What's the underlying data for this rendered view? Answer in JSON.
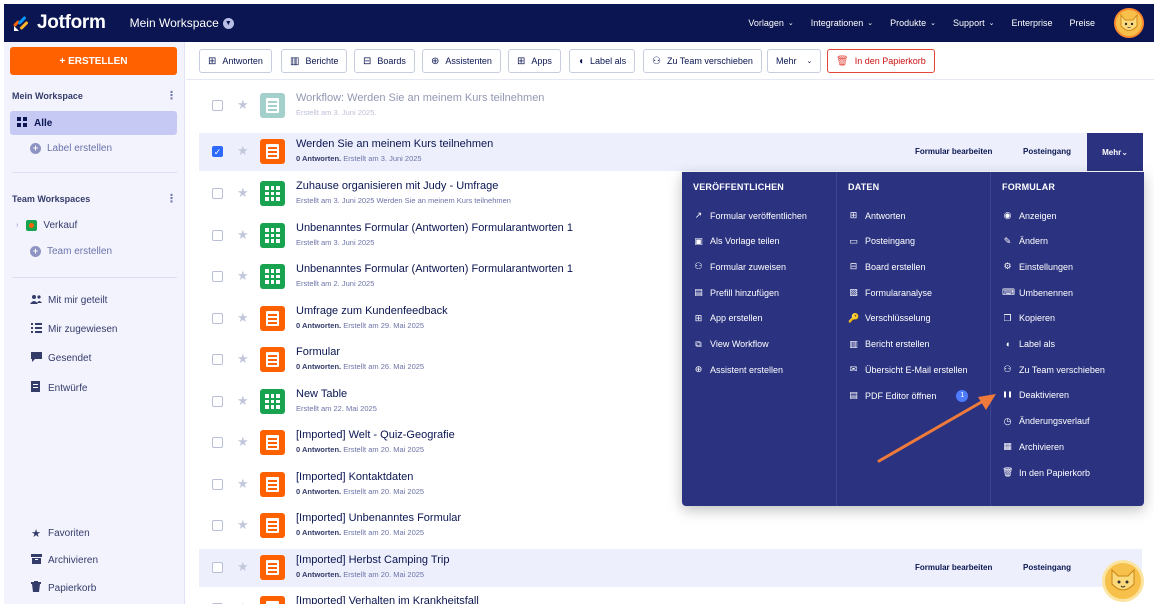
{
  "header": {
    "logo_text": "Jotform",
    "workspace": "Mein Workspace",
    "nav": [
      "Vorlagen",
      "Integrationen",
      "Produkte",
      "Support",
      "Enterprise",
      "Preise"
    ],
    "nav_chevrons": [
      true,
      true,
      true,
      true,
      false,
      false
    ]
  },
  "sidebar": {
    "create_label": "+ ERSTELLEN",
    "section_workspace": "Mein Workspace",
    "all_label": "Alle",
    "create_label_link": "Label erstellen",
    "section_team": "Team Workspaces",
    "team_name": "Verkauf",
    "create_team": "Team erstellen",
    "shared": "Mit mir geteilt",
    "assigned": "Mir zugewiesen",
    "sent": "Gesendet",
    "drafts": "Entwürfe",
    "favorites": "Favoriten",
    "archive": "Archivieren",
    "trash": "Papierkorb"
  },
  "toolbar": {
    "buttons": [
      "Antworten",
      "Berichte",
      "Boards",
      "Assistenten",
      "Apps",
      "Label als",
      "Zu Team verschieben",
      "Mehr",
      "In den Papierkorb"
    ]
  },
  "forms": [
    {
      "title": "Workflow: Werden Sie an meinem Kurs teilnehmen",
      "sub_bold": "",
      "sub": "Erstellt am 3. Juni 2025.",
      "icon": "gray",
      "faded": true,
      "selected": false
    },
    {
      "title": "Werden Sie an meinem Kurs teilnehmen",
      "sub_bold": "0 Antworten.",
      "sub": " Erstellt am 3. Juni 2025",
      "icon": "orange",
      "faded": false,
      "selected": true
    },
    {
      "title": "Zuhause organisieren mit Judy - Umfrage",
      "sub_bold": "",
      "sub": "Erstellt am 3. Juni 2025 Werden Sie an meinem Kurs teilnehmen",
      "icon": "green",
      "faded": false,
      "selected": false
    },
    {
      "title": "Unbenanntes Formular (Antworten) Formularantworten 1",
      "sub_bold": "",
      "sub": "Erstellt am 3. Juni 2025",
      "icon": "green",
      "faded": false,
      "selected": false
    },
    {
      "title": "Unbenanntes Formular (Antworten) Formularantworten 1",
      "sub_bold": "",
      "sub": "Erstellt am 2. Juni 2025",
      "icon": "green",
      "faded": false,
      "selected": false
    },
    {
      "title": "Umfrage zum Kundenfeedback",
      "sub_bold": "0 Antworten.",
      "sub": " Erstellt am 29. Mai 2025",
      "icon": "orange",
      "faded": false,
      "selected": false
    },
    {
      "title": "Formular",
      "sub_bold": "0 Antworten.",
      "sub": " Erstellt am 26. Mai 2025",
      "icon": "orange",
      "faded": false,
      "selected": false
    },
    {
      "title": "New Table",
      "sub_bold": "",
      "sub": "Erstellt am 22. Mai 2025",
      "icon": "green",
      "faded": false,
      "selected": false
    },
    {
      "title": "[Imported] Welt - Quiz-Geografie",
      "sub_bold": "0 Antworten.",
      "sub": " Erstellt am 20. Mai 2025",
      "icon": "orange",
      "faded": false,
      "selected": false
    },
    {
      "title": "[Imported] Kontaktdaten",
      "sub_bold": "0 Antworten.",
      "sub": " Erstellt am 20. Mai 2025",
      "icon": "orange",
      "faded": false,
      "selected": false
    },
    {
      "title": "[Imported] Unbenanntes Formular",
      "sub_bold": "0 Antworten.",
      "sub": " Erstellt am 20. Mai 2025",
      "icon": "orange",
      "faded": false,
      "selected": false
    },
    {
      "title": "[Imported] Herbst Camping Trip",
      "sub_bold": "0 Antworten.",
      "sub": " Erstellt am 20. Mai 2025",
      "icon": "orange",
      "faded": false,
      "selected": false
    },
    {
      "title": "[Imported] Verhalten im Krankheitsfall",
      "sub_bold": "",
      "sub": "",
      "icon": "orange",
      "faded": false,
      "selected": false
    }
  ],
  "row_actions": {
    "edit": "Formular bearbeiten",
    "inbox": "Posteingang",
    "more": "Mehr"
  },
  "menu": {
    "col1_title": "VERÖFFENTLICHEN",
    "col1": [
      "Formular veröffentlichen",
      "Als Vorlage teilen",
      "Formular zuweisen",
      "Prefill hinzufügen",
      "App erstellen",
      "View Workflow",
      "Assistent erstellen"
    ],
    "col2_title": "DATEN",
    "col2": [
      "Antworten",
      "Posteingang",
      "Board erstellen",
      "Formularanalyse",
      "Verschlüsselung",
      "Bericht erstellen",
      "Übersicht E-Mail erstellen",
      "PDF Editor öffnen"
    ],
    "col2_badge": "1",
    "col3_title": "FORMULAR",
    "col3": [
      "Anzeigen",
      "Ändern",
      "Einstellungen",
      "Umbenennen",
      "Kopieren",
      "Label als",
      "Zu Team verschieben",
      "Deaktivieren",
      "Änderungsverlauf",
      "Archivieren",
      "In den Papierkorb"
    ]
  },
  "colors": {
    "navy": "#0a1551",
    "orange": "#ff6100",
    "menu_bg": "#2b3380",
    "arrow": "#f07a3a"
  }
}
